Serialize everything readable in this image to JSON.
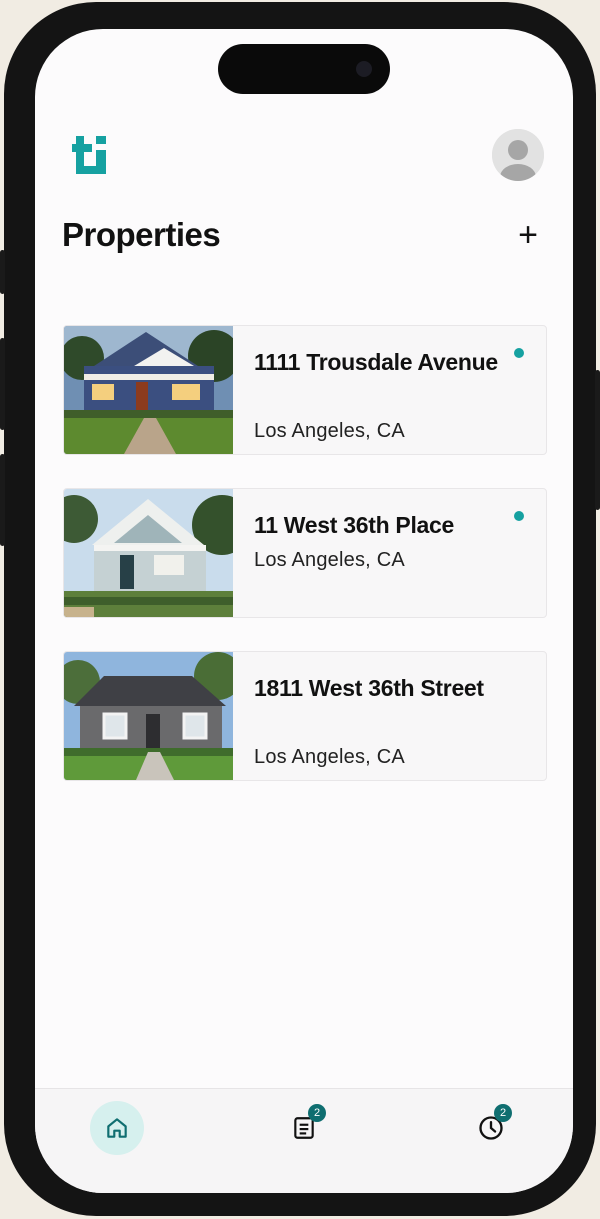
{
  "header": {
    "logo": "ti-logo",
    "avatar_icon": "user-avatar-icon"
  },
  "page": {
    "title": "Properties",
    "add_label": "+"
  },
  "properties": [
    {
      "address": "1111 Trousdale Avenue",
      "city": "Los Angeles, CA",
      "has_update": true
    },
    {
      "address": "11 West 36th Place",
      "city": "Los Angeles, CA",
      "has_update": true
    },
    {
      "address": "1811 West 36th Street",
      "city": "Los Angeles, CA",
      "has_update": false
    }
  ],
  "tabbar": {
    "home": {
      "icon": "home-icon",
      "active": true
    },
    "documents": {
      "icon": "document-icon",
      "badge": "2"
    },
    "history": {
      "icon": "clock-icon",
      "badge": "2"
    }
  },
  "colors": {
    "accent": "#16a1a1",
    "badge": "#0f6e70",
    "active_tab": "#d6f0ee"
  }
}
